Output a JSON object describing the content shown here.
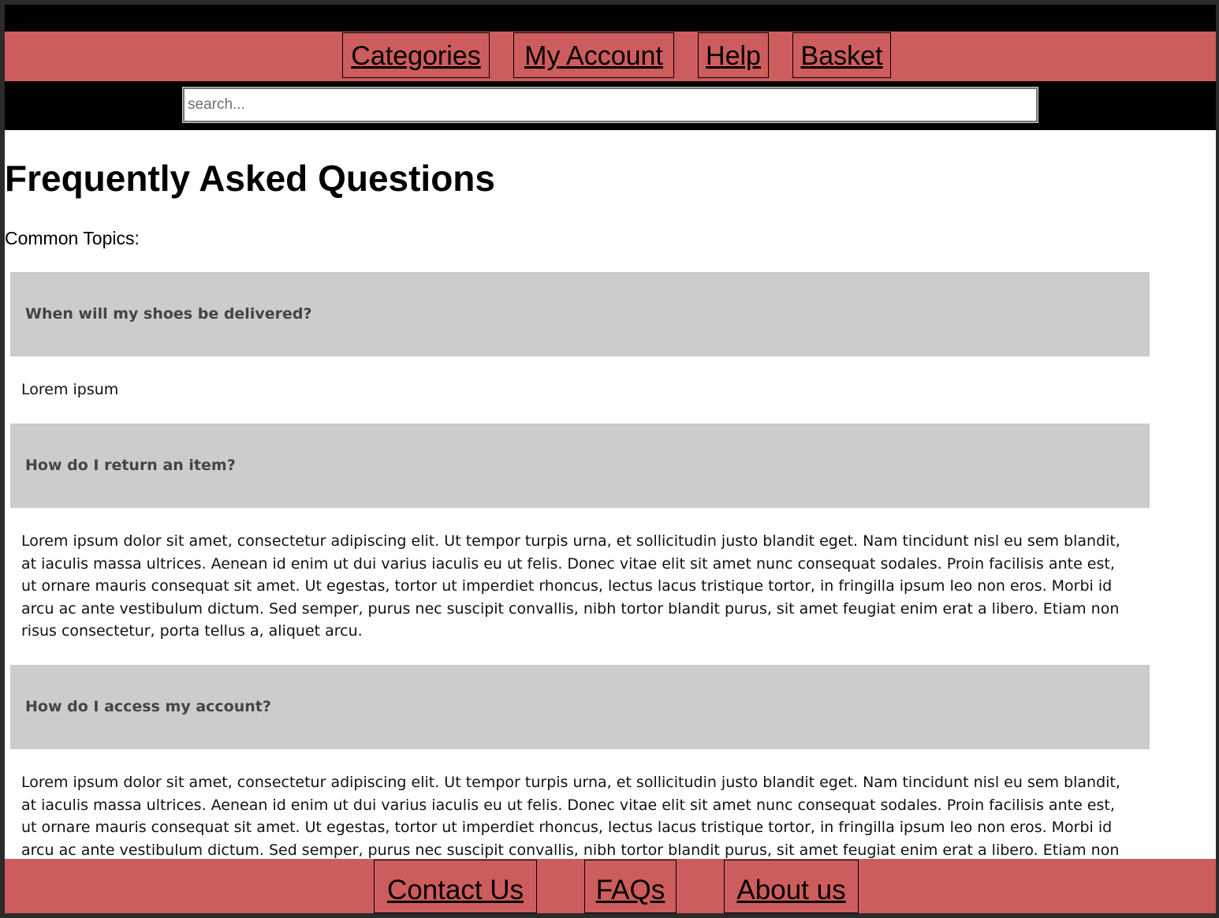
{
  "nav": {
    "items": [
      {
        "label": "Categories"
      },
      {
        "label": "My Account"
      },
      {
        "label": "Help"
      },
      {
        "label": "Basket"
      }
    ]
  },
  "search": {
    "placeholder": "search..."
  },
  "main": {
    "title": "Frequently Asked Questions",
    "topics_label": "Common Topics:",
    "faqs": [
      {
        "question": "When will my shoes be delivered?",
        "answer": "Lorem ipsum"
      },
      {
        "question": "How do I return an item?",
        "answer": "Lorem ipsum dolor sit amet, consectetur adipiscing elit. Ut tempor turpis urna, et sollicitudin justo blandit eget. Nam tincidunt nisl eu sem blandit, at iaculis massa ultrices. Aenean id enim ut dui varius iaculis eu ut felis. Donec vitae elit sit amet nunc consequat sodales. Proin facilisis ante est, ut ornare mauris consequat sit amet. Ut egestas, tortor ut imperdiet rhoncus, lectus lacus tristique tortor, in fringilla ipsum leo non eros. Morbi id arcu ac ante vestibulum dictum. Sed semper, purus nec suscipit convallis, nibh tortor blandit purus, sit amet feugiat enim erat a libero. Etiam non risus consectetur, porta tellus a, aliquet arcu."
      },
      {
        "question": "How do I access my account?",
        "answer": "Lorem ipsum dolor sit amet, consectetur adipiscing elit. Ut tempor turpis urna, et sollicitudin justo blandit eget. Nam tincidunt nisl eu sem blandit, at iaculis massa ultrices. Aenean id enim ut dui varius iaculis eu ut felis. Donec vitae elit sit amet nunc consequat sodales. Proin facilisis ante est, ut ornare mauris consequat sit amet. Ut egestas, tortor ut imperdiet rhoncus, lectus lacus tristique tortor, in fringilla ipsum leo non eros. Morbi id arcu ac ante vestibulum dictum. Sed semper, purus nec suscipit convallis, nibh tortor blandit purus, sit amet feugiat enim erat a libero. Etiam non risus consectetur, porta tellus a, aliquet arcu."
      }
    ]
  },
  "footer": {
    "items": [
      {
        "label": "Contact Us"
      },
      {
        "label": "FAQs"
      },
      {
        "label": "About us"
      }
    ]
  },
  "colors": {
    "nav_background": "#cd5c5c",
    "bar_background": "#000000",
    "question_background": "#cccccc"
  }
}
